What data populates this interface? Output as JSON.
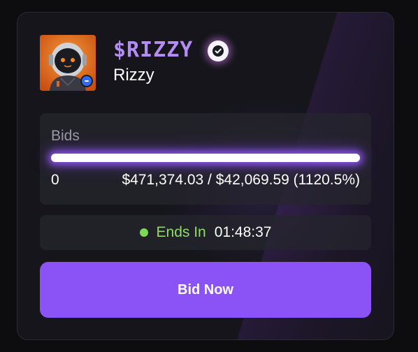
{
  "token": {
    "ticker": "$RIZZY",
    "name": "Rizzy",
    "verified": true,
    "avatar_icon": "astronaut-avatar",
    "accent_color": "#b48cf5"
  },
  "bids": {
    "label": "Bids",
    "count": "0",
    "amount_text": "$471,374.03 / $42,069.59 (1120.5%)",
    "raised": 471374.03,
    "target": 42069.59,
    "percent": 1120.5,
    "progress_fill": 1.0
  },
  "auction": {
    "status_color": "#7ed957",
    "ends_label": "Ends In",
    "countdown": "01:48:37"
  },
  "actions": {
    "bid_label": "Bid Now",
    "button_color": "#8b52f5"
  }
}
